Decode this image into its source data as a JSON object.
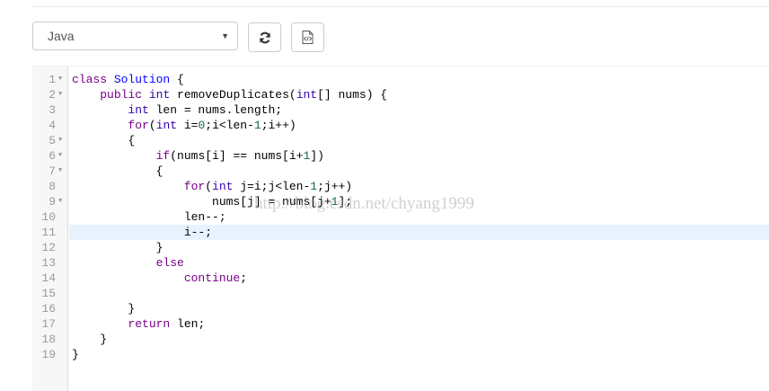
{
  "toolbar": {
    "language": "Java",
    "reset_icon": "refresh-icon",
    "snippet_icon": "code-file-icon"
  },
  "watermark": "http://blog.csdn.net/chyang1999",
  "editor": {
    "active_line": 11,
    "lines": [
      {
        "n": "1",
        "fold": true,
        "tokens": [
          [
            "kw",
            "class"
          ],
          [
            "",
            ""
          ],
          [
            "",
            ""
          ],
          [
            "",
            " "
          ],
          [
            "df",
            "Solution"
          ],
          [
            "",
            " {"
          ]
        ]
      },
      {
        "n": "2",
        "fold": true,
        "tokens": [
          [
            "",
            "    "
          ],
          [
            "kw",
            "public"
          ],
          [
            "",
            " "
          ],
          [
            "ty",
            "int"
          ],
          [
            "",
            " removeDuplicates("
          ],
          [
            "ty",
            "int"
          ],
          [
            "",
            "[] nums) {"
          ]
        ]
      },
      {
        "n": "3",
        "fold": false,
        "tokens": [
          [
            "",
            "        "
          ],
          [
            "ty",
            "int"
          ],
          [
            "",
            " len = nums.length;"
          ]
        ]
      },
      {
        "n": "4",
        "fold": false,
        "tokens": [
          [
            "",
            "        "
          ],
          [
            "kw",
            "for"
          ],
          [
            "",
            "("
          ],
          [
            "ty",
            "int"
          ],
          [
            "",
            " i="
          ],
          [
            "nm",
            "0"
          ],
          [
            "",
            ";i<len-"
          ],
          [
            "nm",
            "1"
          ],
          [
            "",
            ";i++)"
          ]
        ]
      },
      {
        "n": "5",
        "fold": true,
        "tokens": [
          [
            "",
            "        {"
          ]
        ]
      },
      {
        "n": "6",
        "fold": true,
        "tokens": [
          [
            "",
            "            "
          ],
          [
            "kw",
            "if"
          ],
          [
            "",
            "(nums[i] == nums[i+"
          ],
          [
            "nm",
            "1"
          ],
          [
            "",
            "])"
          ]
        ]
      },
      {
        "n": "7",
        "fold": true,
        "tokens": [
          [
            "",
            "            {"
          ]
        ]
      },
      {
        "n": "8",
        "fold": false,
        "tokens": [
          [
            "",
            "                "
          ],
          [
            "kw",
            "for"
          ],
          [
            "",
            "("
          ],
          [
            "ty",
            "int"
          ],
          [
            "",
            " j=i;j<len-"
          ],
          [
            "nm",
            "1"
          ],
          [
            "",
            ";j++)"
          ]
        ]
      },
      {
        "n": "9",
        "fold": true,
        "tokens": [
          [
            "",
            "                    nums[j] = nums[j+"
          ],
          [
            "nm",
            "1"
          ],
          [
            "",
            "];"
          ]
        ]
      },
      {
        "n": "10",
        "fold": false,
        "tokens": [
          [
            "",
            "                len--;"
          ]
        ]
      },
      {
        "n": "11",
        "fold": false,
        "tokens": [
          [
            "",
            "                i--;"
          ]
        ]
      },
      {
        "n": "12",
        "fold": false,
        "tokens": [
          [
            "",
            "            }"
          ]
        ]
      },
      {
        "n": "13",
        "fold": false,
        "tokens": [
          [
            "",
            "            "
          ],
          [
            "kw",
            "else"
          ]
        ]
      },
      {
        "n": "14",
        "fold": false,
        "tokens": [
          [
            "",
            "                "
          ],
          [
            "kw",
            "continue"
          ],
          [
            "",
            ";"
          ]
        ]
      },
      {
        "n": "15",
        "fold": false,
        "tokens": [
          [
            "",
            ""
          ]
        ]
      },
      {
        "n": "16",
        "fold": false,
        "tokens": [
          [
            "",
            "        }"
          ]
        ]
      },
      {
        "n": "17",
        "fold": false,
        "tokens": [
          [
            "",
            "        "
          ],
          [
            "kw",
            "return"
          ],
          [
            "",
            " len;"
          ]
        ]
      },
      {
        "n": "18",
        "fold": false,
        "tokens": [
          [
            "",
            "    }"
          ]
        ]
      },
      {
        "n": "19",
        "fold": false,
        "tokens": [
          [
            "",
            "}"
          ]
        ]
      }
    ]
  }
}
